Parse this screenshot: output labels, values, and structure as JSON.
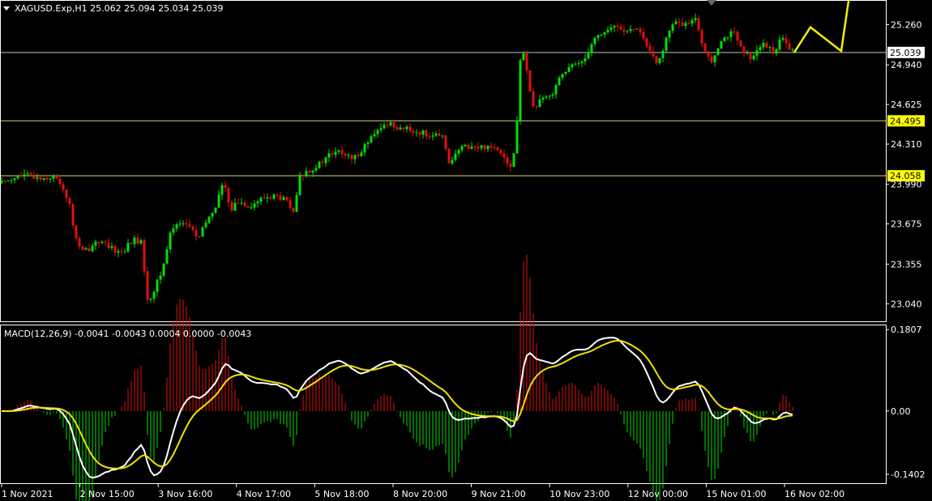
{
  "header": {
    "symbol_line": "XAGUSD.Exp,H1  25.062 25.094 25.034 25.039"
  },
  "macd_header": "MACD(12,26,9) -0.0041 -0.0043 0.0004 0.0000 -0.0043",
  "colors": {
    "bull": "#00e000",
    "bear": "#e01010",
    "hline": "#d8d870",
    "macd_line": "#ffffff",
    "signal_line": "#f0e000",
    "arrow": "#f0f000"
  },
  "chart_data": [
    {
      "type": "candlestick",
      "symbol": "XAGUSD.Exp",
      "timeframe": "H1",
      "ohlc": {
        "open": 25.062,
        "high": 25.094,
        "low": 25.034,
        "close": 25.039
      },
      "ylim": [
        22.9,
        25.45
      ],
      "y_ticks": [
        25.26,
        24.94,
        24.625,
        24.31,
        23.99,
        23.675,
        23.355,
        23.04
      ],
      "x_ticks": [
        "1 Nov 2021",
        "2 Nov 15:00",
        "3 Nov 16:00",
        "4 Nov 17:00",
        "5 Nov 18:00",
        "8 Nov 20:00",
        "9 Nov 21:00",
        "10 Nov 23:00",
        "12 Nov 00:00",
        "15 Nov 01:00",
        "16 Nov 02:00"
      ],
      "horizontal_levels": [
        {
          "value": 25.039,
          "label": "25.039",
          "label_bg": "#ffffff",
          "label_fg": "#000000"
        },
        {
          "value": 24.495,
          "label": "24.495",
          "label_bg": "#ffff00",
          "label_fg": "#000000"
        },
        {
          "value": 24.058,
          "label": "24.058",
          "label_bg": "#ffff00",
          "label_fg": "#000000"
        }
      ],
      "path_closes": [
        [
          0,
          24.0
        ],
        [
          10,
          24.03
        ],
        [
          20,
          24.05
        ],
        [
          35,
          24.06
        ],
        [
          50,
          24.04
        ],
        [
          65,
          24.05
        ],
        [
          75,
          24.0
        ],
        [
          85,
          23.85
        ],
        [
          92,
          23.6
        ],
        [
          100,
          23.45
        ],
        [
          110,
          23.48
        ],
        [
          120,
          23.55
        ],
        [
          135,
          23.48
        ],
        [
          150,
          23.45
        ],
        [
          165,
          23.55
        ],
        [
          175,
          23.52
        ],
        [
          182,
          23.05
        ],
        [
          190,
          23.15
        ],
        [
          200,
          23.3
        ],
        [
          210,
          23.6
        ],
        [
          220,
          23.7
        ],
        [
          235,
          23.65
        ],
        [
          245,
          23.55
        ],
        [
          255,
          23.7
        ],
        [
          265,
          23.8
        ],
        [
          275,
          24.0
        ],
        [
          285,
          23.8
        ],
        [
          295,
          23.85
        ],
        [
          310,
          23.82
        ],
        [
          325,
          23.88
        ],
        [
          340,
          23.9
        ],
        [
          355,
          23.85
        ],
        [
          362,
          23.75
        ],
        [
          370,
          24.05
        ],
        [
          380,
          24.1
        ],
        [
          395,
          24.15
        ],
        [
          405,
          24.22
        ],
        [
          420,
          24.25
        ],
        [
          435,
          24.18
        ],
        [
          450,
          24.3
        ],
        [
          465,
          24.4
        ],
        [
          478,
          24.48
        ],
        [
          490,
          24.45
        ],
        [
          505,
          24.42
        ],
        [
          520,
          24.4
        ],
        [
          535,
          24.38
        ],
        [
          548,
          24.35
        ],
        [
          555,
          24.15
        ],
        [
          565,
          24.25
        ],
        [
          575,
          24.3
        ],
        [
          590,
          24.28
        ],
        [
          605,
          24.3
        ],
        [
          620,
          24.25
        ],
        [
          632,
          24.1
        ],
        [
          638,
          24.5
        ],
        [
          643,
          25.1
        ],
        [
          650,
          24.9
        ],
        [
          658,
          24.6
        ],
        [
          668,
          24.65
        ],
        [
          680,
          24.7
        ],
        [
          690,
          24.85
        ],
        [
          700,
          24.9
        ],
        [
          712,
          24.95
        ],
        [
          722,
          25.0
        ],
        [
          732,
          25.15
        ],
        [
          745,
          25.2
        ],
        [
          760,
          25.25
        ],
        [
          775,
          25.2
        ],
        [
          790,
          25.22
        ],
        [
          800,
          25.05
        ],
        [
          810,
          24.95
        ],
        [
          820,
          25.1
        ],
        [
          830,
          25.28
        ],
        [
          845,
          25.25
        ],
        [
          860,
          25.3
        ],
        [
          868,
          25.05
        ],
        [
          878,
          24.98
        ],
        [
          890,
          25.15
        ],
        [
          905,
          25.2
        ],
        [
          915,
          25.05
        ],
        [
          925,
          25.0
        ],
        [
          940,
          25.1
        ],
        [
          955,
          25.05
        ],
        [
          965,
          25.15
        ],
        [
          975,
          25.05
        ],
        [
          980,
          25.039
        ]
      ]
    },
    {
      "type": "line",
      "name": "MACD(12,26,9)",
      "values_text": "-0.0041 -0.0043 0.0004 0.0000 -0.0043",
      "ylim": [
        -0.16,
        0.19
      ],
      "y_ticks": [
        0.1807,
        0.0,
        -0.1402
      ]
    }
  ],
  "forecast_arrow": [
    [
      980,
      25.039
    ],
    [
      1000,
      25.24
    ],
    [
      1038,
      25.05
    ],
    [
      1055,
      25.8
    ]
  ]
}
